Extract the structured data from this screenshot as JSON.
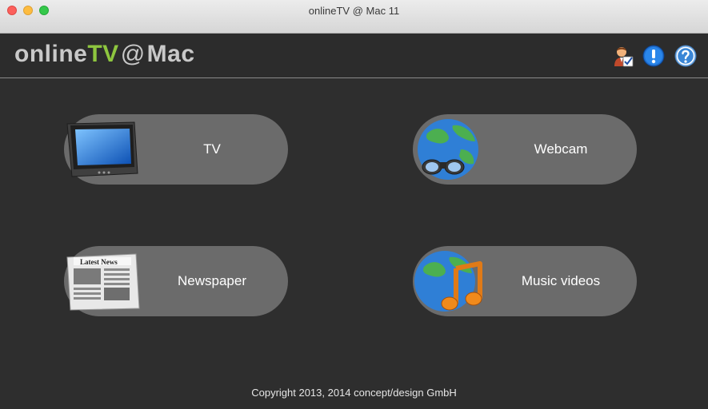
{
  "window": {
    "title": "onlineTV @ Mac 11"
  },
  "logo": {
    "part1": "online",
    "part2": "TV",
    "part3": "@",
    "part4": "Mac"
  },
  "header_icons": [
    "user-check-icon",
    "alert-icon",
    "help-icon"
  ],
  "tiles": [
    {
      "label": "TV",
      "icon": "tv-icon"
    },
    {
      "label": "Webcam",
      "icon": "webcam-globe-icon"
    },
    {
      "label": "Newspaper",
      "icon": "newspaper-icon"
    },
    {
      "label": "Music videos",
      "icon": "music-globe-icon"
    }
  ],
  "newspaper_headline": "Latest News",
  "footer": {
    "copyright": "Copyright 2013, 2014 concept/design GmbH"
  },
  "colors": {
    "background": "#2e2e2e",
    "pill": "#6b6b6b",
    "accent": "#8ec63f",
    "header_icon_blue": "#1f6fd0"
  }
}
